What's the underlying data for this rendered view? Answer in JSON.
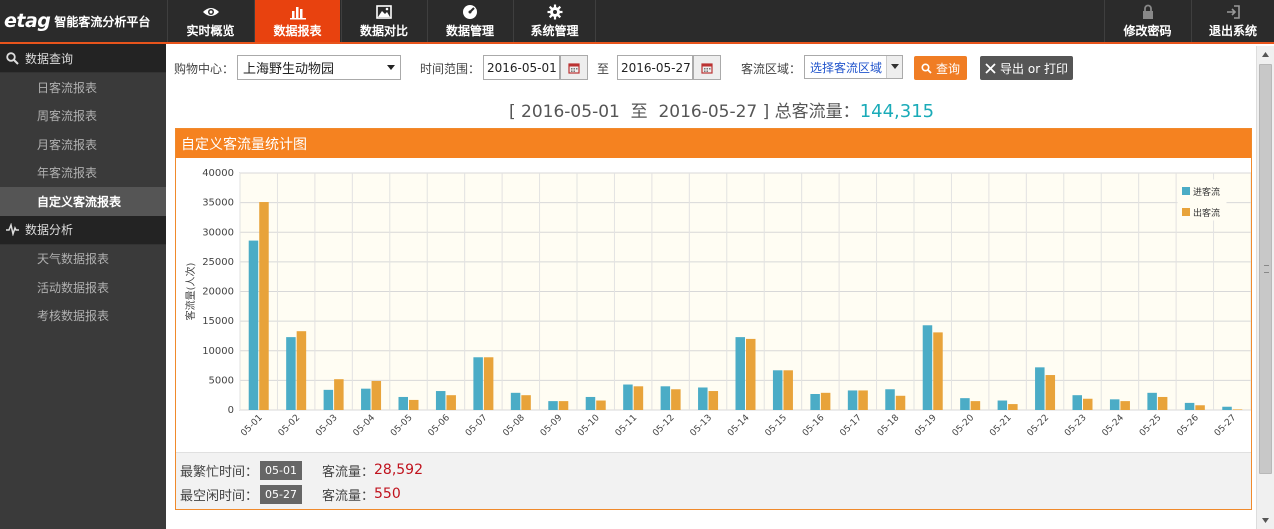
{
  "app": {
    "logo_mark": "etag",
    "logo_text": "智能客流分析平台"
  },
  "nav": {
    "items": [
      {
        "label": "实时概览",
        "icon": "eye-icon"
      },
      {
        "label": "数据报表",
        "icon": "bar-chart-icon",
        "active": true
      },
      {
        "label": "数据对比",
        "icon": "image-chart-icon"
      },
      {
        "label": "数据管理",
        "icon": "dashboard-icon"
      },
      {
        "label": "系统管理",
        "icon": "gear-icon"
      }
    ],
    "right": [
      {
        "label": "修改密码",
        "icon": "lock-icon"
      },
      {
        "label": "退出系统",
        "icon": "logout-icon"
      }
    ],
    "accent_color": "#e8420f"
  },
  "sidebar": {
    "sections": [
      {
        "title": "数据查询",
        "icon": "search-icon",
        "items": [
          "日客流报表",
          "周客流报表",
          "月客流报表",
          "年客流报表",
          "自定义客流报表"
        ],
        "active_index": 4
      },
      {
        "title": "数据分析",
        "icon": "pulse-icon",
        "items": [
          "天气数据报表",
          "活动数据报表",
          "考核数据报表"
        ]
      }
    ]
  },
  "filters": {
    "mall_label": "购物中心：",
    "mall_value": "上海野生动物园",
    "range_label": "时间范围：",
    "start_date": "2016-05-01",
    "to_label": "至",
    "end_date": "2016-05-27",
    "region_label": "客流区域：",
    "region_value": "选择客流区域",
    "query_button": "查询",
    "export_button": "导出 or 打印"
  },
  "summary": {
    "prefix": "[ 2016-05-01  至  2016-05-27 ] 总客流量：",
    "total": "144,315"
  },
  "panel": {
    "title": "自定义客流量统计图"
  },
  "chart_data": {
    "type": "bar",
    "title": "",
    "xlabel": "",
    "ylabel": "客流量(人次)",
    "ylim": [
      0,
      40000
    ],
    "yticks": [
      0,
      5000,
      10000,
      15000,
      20000,
      25000,
      30000,
      35000,
      40000
    ],
    "grid": true,
    "legend_position": "top-right",
    "categories": [
      "05-01",
      "05-02",
      "05-03",
      "05-04",
      "05-05",
      "05-06",
      "05-07",
      "05-08",
      "05-09",
      "05-10",
      "05-11",
      "05-12",
      "05-13",
      "05-14",
      "05-15",
      "05-16",
      "05-17",
      "05-18",
      "05-19",
      "05-20",
      "05-21",
      "05-22",
      "05-23",
      "05-24",
      "05-25",
      "05-26",
      "05-27"
    ],
    "series": [
      {
        "name": "进客流",
        "color": "#4bacc6",
        "values": [
          28592,
          12300,
          3400,
          3600,
          2200,
          3200,
          8900,
          2900,
          1500,
          2200,
          4300,
          4000,
          3800,
          12300,
          6700,
          2700,
          3300,
          3500,
          14300,
          2000,
          1600,
          7200,
          2500,
          1800,
          2900,
          1200,
          550
        ]
      },
      {
        "name": "出客流",
        "color": "#e8a33a",
        "values": [
          35100,
          13300,
          5200,
          4900,
          1700,
          2500,
          8900,
          2500,
          1500,
          1600,
          4000,
          3500,
          3200,
          12000,
          6700,
          2900,
          3300,
          2400,
          13100,
          1500,
          1000,
          5900,
          1900,
          1500,
          2200,
          800,
          100
        ]
      }
    ]
  },
  "stats": {
    "busiest_label": "最繁忙时间：",
    "busiest_date": "05-01",
    "busiest_flow_label": "客流量：",
    "busiest_flow": "28,592",
    "idlest_label": "最空闲时间：",
    "idlest_date": "05-27",
    "idlest_flow_label": "客流量：",
    "idlest_flow": "550"
  }
}
